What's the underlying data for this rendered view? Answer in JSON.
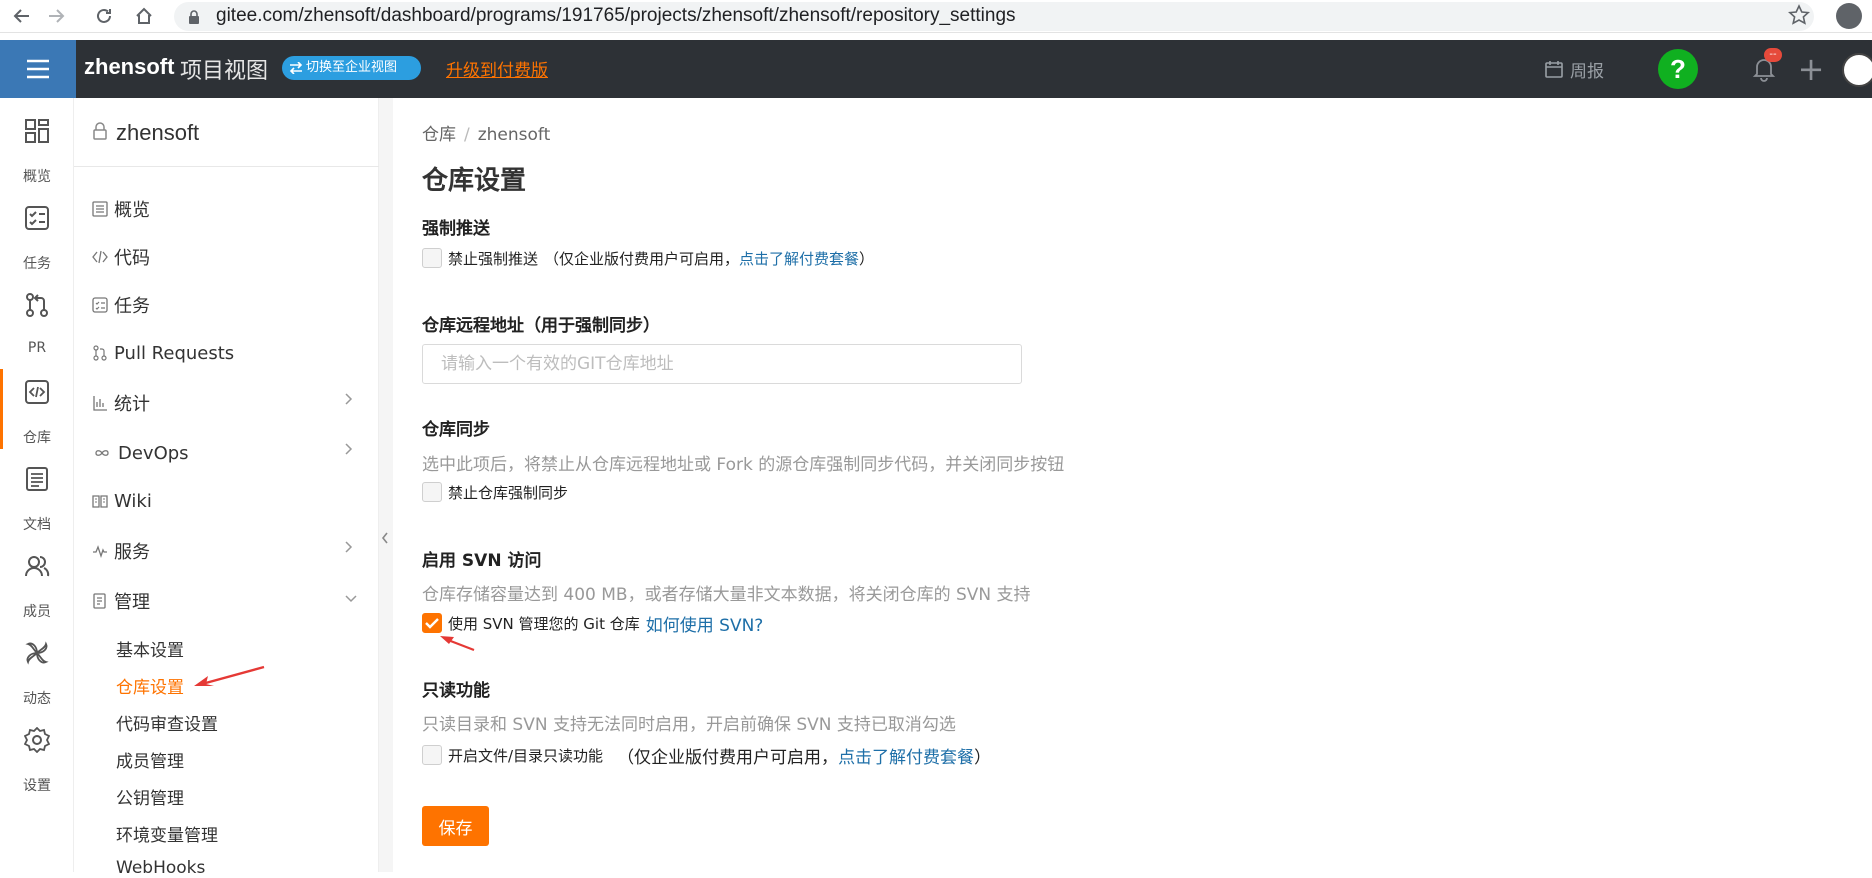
{
  "browser": {
    "url": "gitee.com/zhensoft/dashboard/programs/191765/projects/zhensoft/zhensoft/repository_settings"
  },
  "header": {
    "brand": "zhensoft",
    "view_label": "项目视图",
    "switch_label": "切换至企业视图",
    "upgrade_label": "升级到付费版",
    "weekly_label": "周报",
    "help_label": "?",
    "notification_badge": "--",
    "accent_color": "#fe7300",
    "header_color": "#2d3136",
    "menu_color": "#3b78b5"
  },
  "rail": {
    "items": [
      {
        "label": "概览",
        "icon": "grid-icon"
      },
      {
        "label": "任务",
        "icon": "task-icon"
      },
      {
        "label": "PR",
        "icon": "pull-request-icon"
      },
      {
        "label": "仓库",
        "icon": "code-icon"
      },
      {
        "label": "文档",
        "icon": "document-icon"
      },
      {
        "label": "成员",
        "icon": "members-icon"
      },
      {
        "label": "动态",
        "icon": "activity-icon"
      },
      {
        "label": "设置",
        "icon": "gear-icon"
      }
    ],
    "active": "仓库"
  },
  "sidebar": {
    "project_name": "zhensoft",
    "items": [
      {
        "label": "概览"
      },
      {
        "label": "代码"
      },
      {
        "label": "任务"
      },
      {
        "label": "Pull Requests"
      },
      {
        "label": "统计"
      },
      {
        "label": "DevOps"
      },
      {
        "label": "Wiki"
      },
      {
        "label": "服务"
      },
      {
        "label": "管理"
      }
    ],
    "sub_items": [
      {
        "label": "基本设置"
      },
      {
        "label": "仓库设置"
      },
      {
        "label": "代码审查设置"
      },
      {
        "label": "成员管理"
      },
      {
        "label": "公钥管理"
      },
      {
        "label": "环境变量管理"
      },
      {
        "label": "WebHooks"
      }
    ],
    "active_sub": "仓库设置"
  },
  "main": {
    "breadcrumb": {
      "root": "仓库",
      "current": "zhensoft"
    },
    "title": "仓库设置",
    "force_push": {
      "title": "强制推送",
      "checkbox_label": "禁止强制推送",
      "note_prefix": "（仅企业版付费用户可启用，",
      "note_link": "点击了解付费套餐",
      "note_suffix": "）",
      "checked": false
    },
    "remote": {
      "title": "仓库远程地址（用于强制同步）",
      "placeholder": "请输入一个有效的GIT仓库地址",
      "value": ""
    },
    "sync": {
      "title": "仓库同步",
      "desc": "选中此项后，将禁止从仓库远程地址或 Fork 的源仓库强制同步代码，并关闭同步按钮",
      "checkbox_label": "禁止仓库强制同步",
      "checked": false
    },
    "svn": {
      "title": "启用 SVN 访问",
      "desc": "仓库存储容量达到 400 MB，或者存储大量非文本数据，将关闭仓库的 SVN 支持",
      "checkbox_label": "使用 SVN 管理您的 Git 仓库",
      "link": "如何使用 SVN?",
      "checked": true
    },
    "readonly": {
      "title": "只读功能",
      "desc": "只读目录和 SVN 支持无法同时启用，开启前确保 SVN 支持已取消勾选",
      "checkbox_label": "开启文件/目录只读功能",
      "note_prefix": "（仅企业版付费用户可启用，",
      "note_link": "点击了解付费套餐",
      "note_suffix": "）",
      "checked": false
    },
    "save_label": "保存"
  }
}
